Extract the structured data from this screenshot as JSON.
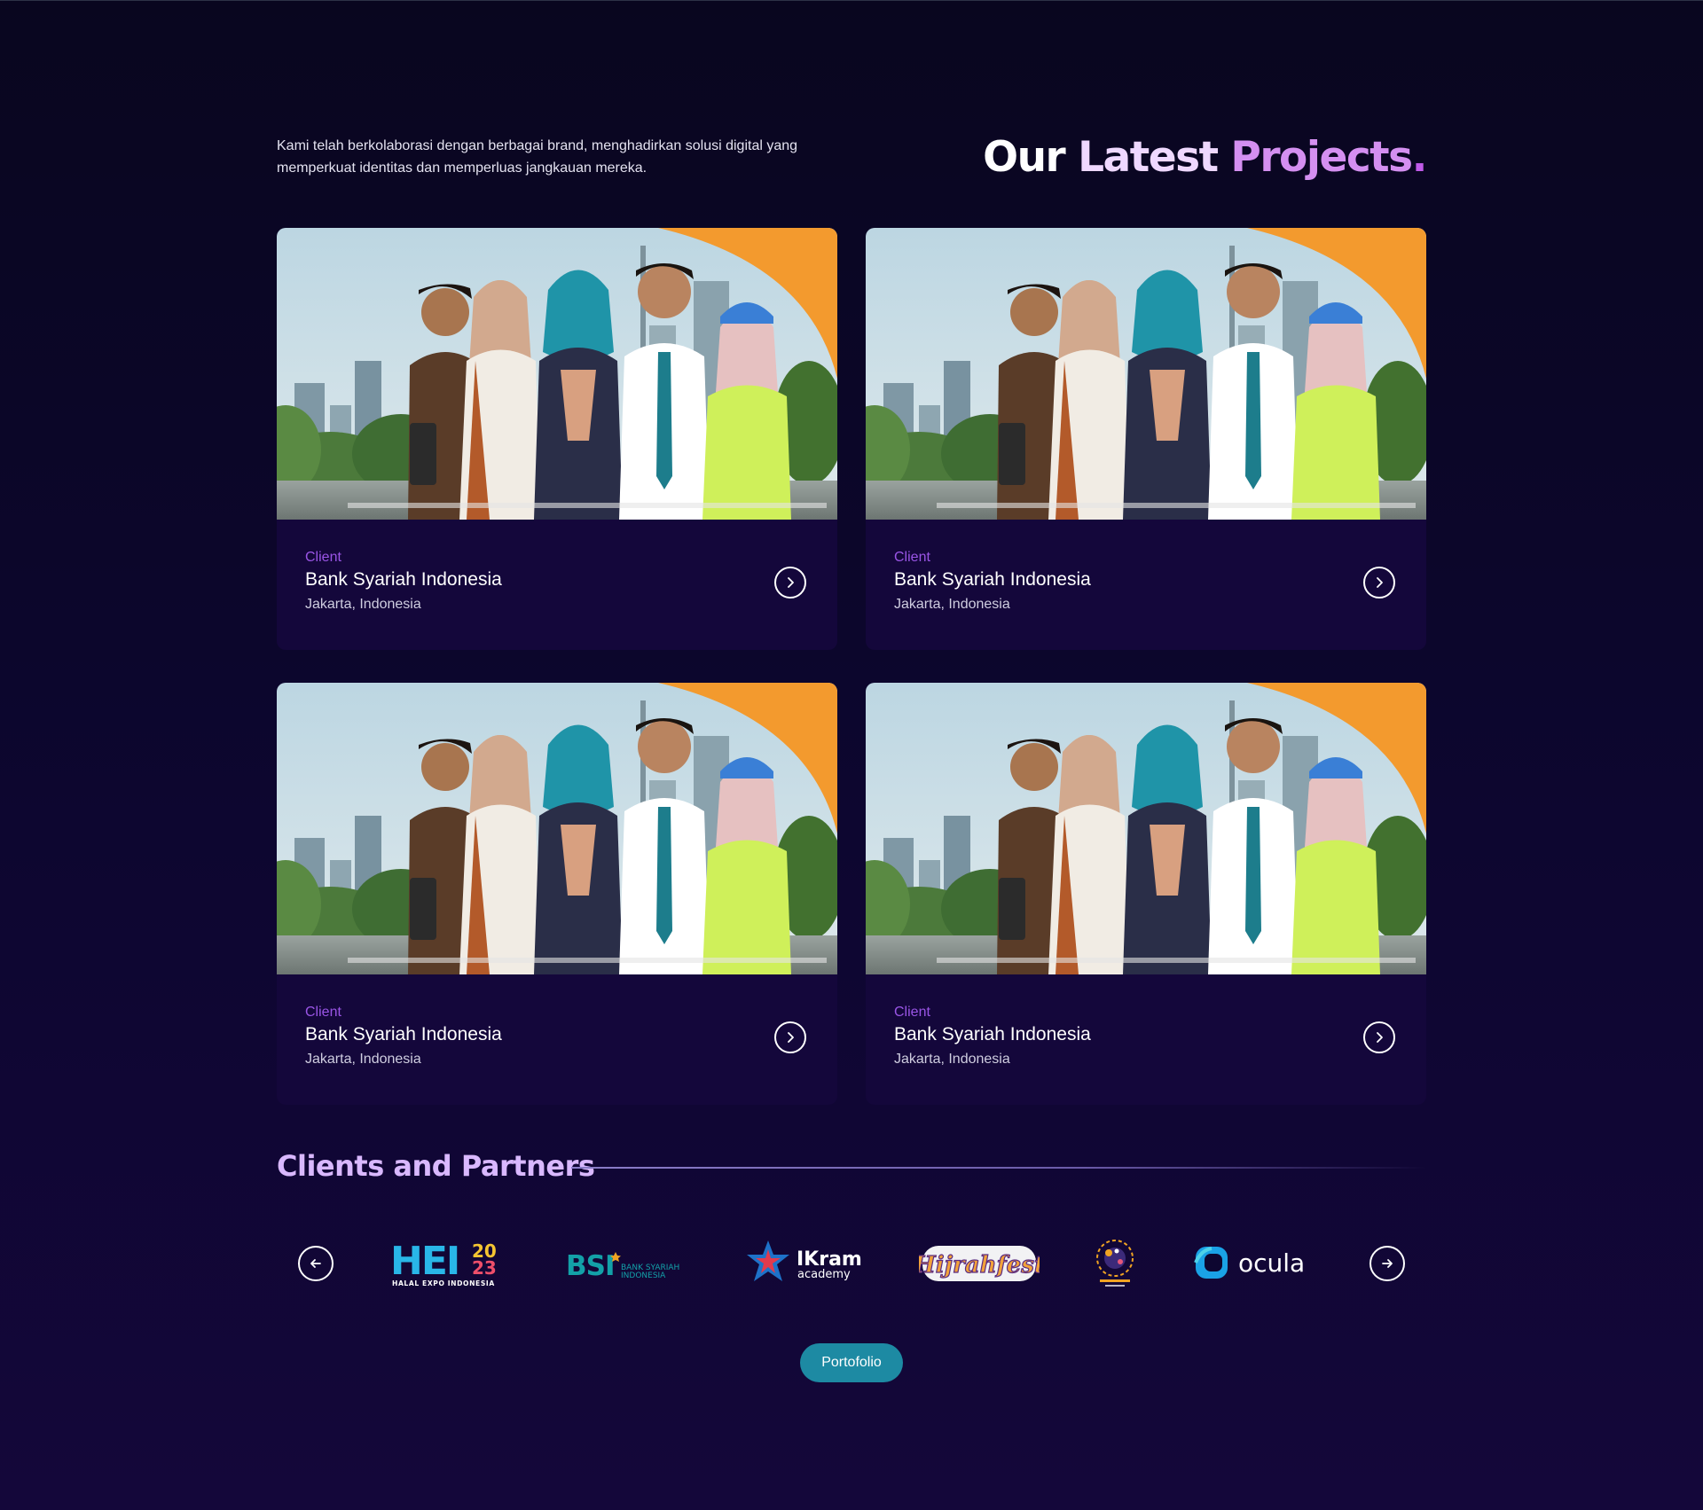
{
  "header": {
    "intro": "Kami telah berkolaborasi dengan berbagai brand, menghadirkan solusi digital yang memperkuat identitas dan memperluas jangkauan mereka.",
    "title_word1": "Our",
    "title_word2": "Latest",
    "title_word3": "Projects",
    "title_dot": "."
  },
  "projects": [
    {
      "label": "Client",
      "name": "Bank Syariah Indonesia",
      "location": "Jakarta, Indonesia"
    },
    {
      "label": "Client",
      "name": "Bank Syariah Indonesia",
      "location": "Jakarta, Indonesia"
    },
    {
      "label": "Client",
      "name": "Bank Syariah Indonesia",
      "location": "Jakarta, Indonesia"
    },
    {
      "label": "Client",
      "name": "Bank Syariah Indonesia",
      "location": "Jakarta, Indonesia"
    }
  ],
  "partners": {
    "title": "Clients and Partners",
    "logos": {
      "hei_main": "HEI",
      "hei_year_top": "20",
      "hei_year_bottom": "23",
      "hei_sub": "HALAL EXPO INDONESIA",
      "bsi_main": "BSI",
      "bsi_sub_line1": "BANK SYARIAH",
      "bsi_sub_line2": "INDONESIA",
      "ikram_main": "IKram",
      "ikram_sub": "academy",
      "hijrahfest": "Hijrahfest",
      "ocula": "ocula"
    }
  },
  "cta": {
    "portfolio_label": "Portofolio"
  },
  "colors": {
    "background": "#0d0630",
    "card": "#14073b",
    "accent_purple": "#9a55e6",
    "title_purple": "#d48ff0",
    "button_teal": "#1d8aa3"
  },
  "icons": {
    "card_arrow": "chevron-right-circle-icon",
    "prev": "arrow-left-icon",
    "next": "arrow-right-icon"
  }
}
